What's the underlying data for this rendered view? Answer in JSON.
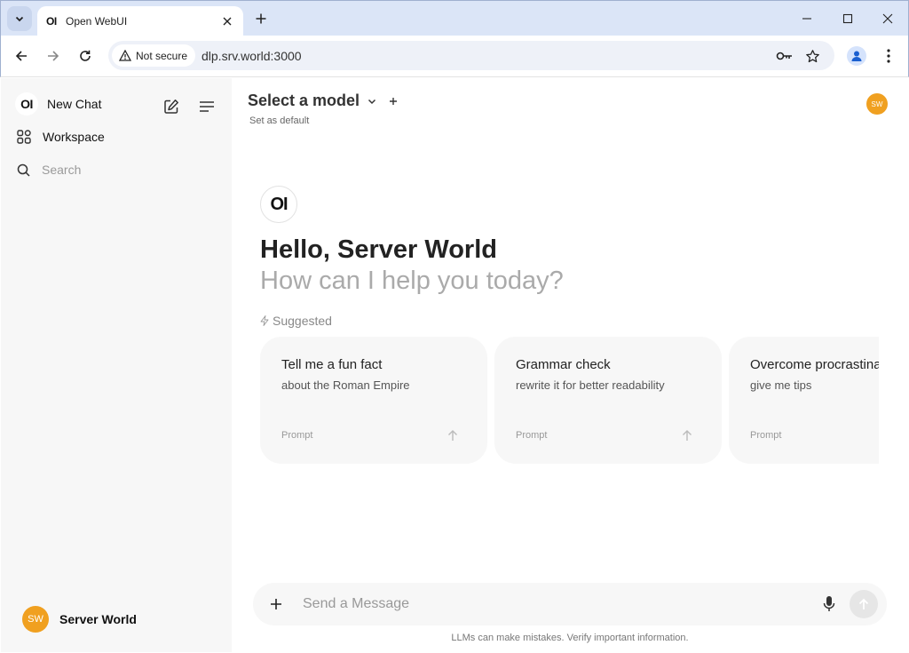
{
  "browser": {
    "tab_title": "Open WebUI",
    "tab_favicon": "OI",
    "security_label": "Not secure",
    "url": "dlp.srv.world:3000"
  },
  "sidebar": {
    "logo": "OI",
    "new_chat_label": "New Chat",
    "workspace_label": "Workspace",
    "search_placeholder": "Search",
    "user": {
      "initials": "SW",
      "name": "Server World"
    }
  },
  "header": {
    "model_select_label": "Select a model",
    "set_default_label": "Set as default",
    "avatar_initials": "SW"
  },
  "hero": {
    "logo": "OI",
    "greeting": "Hello, Server World",
    "subgreeting": "How can I help you today?",
    "suggested_label": "Suggested"
  },
  "suggestions": [
    {
      "title": "Tell me a fun fact",
      "subtitle": "about the Roman Empire",
      "kind": "Prompt"
    },
    {
      "title": "Grammar check",
      "subtitle": "rewrite it for better readability",
      "kind": "Prompt"
    },
    {
      "title": "Overcome procrastination",
      "subtitle": "give me tips",
      "kind": "Prompt"
    }
  ],
  "composer": {
    "placeholder": "Send a Message",
    "disclaimer": "LLMs can make mistakes. Verify important information."
  },
  "colors": {
    "avatar": "#f0a020",
    "sidebar_bg": "#f7f7f7",
    "titlebar_bg": "#dbe5f7"
  }
}
